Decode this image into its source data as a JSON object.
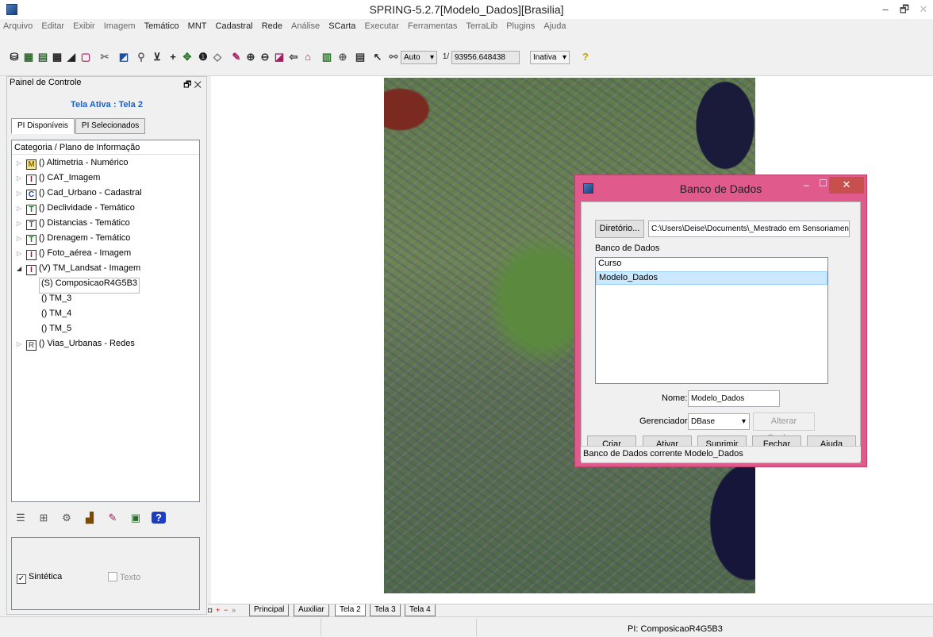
{
  "window": {
    "title": "SPRING-5.2.7[Modelo_Dados][Brasilia]",
    "min": "–",
    "max": "🗗",
    "close": "✕"
  },
  "menu": [
    "Arquivo",
    "Editar",
    "Exibir",
    "Imagem",
    "Temático",
    "MNT",
    "Cadastral",
    "Rede",
    "Análise",
    "SCarta",
    "Executar",
    "Ferramentas",
    "TerraLib",
    "Plugins",
    "Ajuda"
  ],
  "toolbar": {
    "auto": "Auto",
    "auto_arrow": "▾",
    "scale_prefix": "1/",
    "scale": "93956.648438",
    "inativa": "Inativa",
    "inativa_arrow": "▾",
    "help": "?"
  },
  "panel": {
    "title": "Painel de Controle",
    "pin": "🗗 ✕",
    "ativa": "Tela Ativa : Tela 2",
    "tabs": [
      "PI Disponíveis",
      "PI Selecionados"
    ],
    "tree_header": "Categoria / Plano de Informação",
    "items": [
      {
        "arrow": "▷",
        "cat": "M",
        "label": "() Altimetria - Numérico"
      },
      {
        "arrow": "▷",
        "cat": "I",
        "label": "() CAT_Imagem"
      },
      {
        "arrow": "▷",
        "cat": "C",
        "label": "() Cad_Urbano - Cadastral"
      },
      {
        "arrow": "▷",
        "cat": "T",
        "label": "() Declividade - Temático"
      },
      {
        "arrow": "▷",
        "cat": "T",
        "label": "() Distancias - Temático"
      },
      {
        "arrow": "▷",
        "cat": "T",
        "label": "() Drenagem - Temático"
      },
      {
        "arrow": "▷",
        "cat": "I",
        "label": "() Foto_aérea - Imagem"
      },
      {
        "arrow": "◢",
        "cat": "I",
        "label": "(V) TM_Landsat - Imagem"
      },
      {
        "label": "(S) ComposicaoR4G5B3"
      },
      {
        "label": "() TM_3"
      },
      {
        "label": "() TM_4"
      },
      {
        "label": "() TM_5"
      },
      {
        "arrow": "▷",
        "cat": "R",
        "label": "() Vias_Urbanas - Redes"
      }
    ],
    "sintetica": "Sintética",
    "sintetica_check": "✓",
    "texto": "Texto"
  },
  "bottom_tabs": [
    "Principal",
    "Auxiliar",
    "Tela 2",
    "Tela 3",
    "Tela 4"
  ],
  "status": {
    "pi": "PI: ComposicaoR4G5B3"
  },
  "dialog": {
    "title": "Banco de Dados",
    "min": "–",
    "max": "☐",
    "close": "✕",
    "dir_button": "Diretório...",
    "dir_path": "C:\\Users\\Deise\\Documents\\_Mestrado em Sensoriamento Re",
    "list_label": "Banco de Dados",
    "list": [
      "Curso",
      "Modelo_Dados"
    ],
    "selected": 1,
    "nome_label": "Nome:",
    "nome": "Modelo_Dados",
    "ger_label": "Gerenciador:",
    "ger": "DBase",
    "ger_arrow": "▾",
    "alterar": "Alterar Senha...",
    "buttons": [
      "Criar",
      "Ativar",
      "Suprimir",
      "Fechar",
      "Ajuda"
    ],
    "status": "Banco de Dados corrente Modelo_Dados"
  }
}
